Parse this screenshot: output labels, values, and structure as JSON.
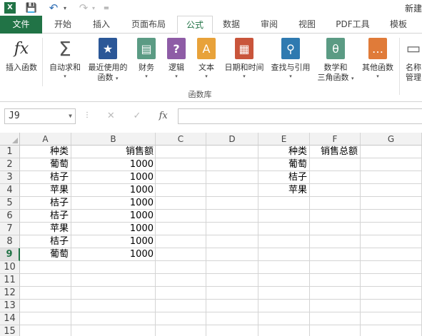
{
  "app": {
    "logo_text": "X",
    "title": "新建",
    "save_glyph": "💾",
    "undo_glyph": "↶",
    "redo_glyph": "↷",
    "dropdown_glyph": "▾",
    "customize_glyph": "="
  },
  "tabs": [
    "文件",
    "开始",
    "插入",
    "页面布局",
    "公式",
    "数据",
    "审阅",
    "视图",
    "PDF工具",
    "模板"
  ],
  "active_tab": "公式",
  "ribbon": {
    "buttons": [
      {
        "id": "insert-function",
        "icon": "fx",
        "label": "插入函数",
        "label2": "",
        "caret": false,
        "color": ""
      },
      {
        "id": "autosum",
        "icon": "Σ",
        "label": "自动求和",
        "label2": "",
        "caret": true,
        "color": ""
      },
      {
        "id": "recent",
        "icon": "★",
        "label": "最近使用的",
        "label2": "函数",
        "caret": true,
        "color": "#2b5797"
      },
      {
        "id": "financial",
        "icon": "▤",
        "label": "财务",
        "label2": "",
        "caret": true,
        "color": "#5b9b84"
      },
      {
        "id": "logical",
        "icon": "?",
        "label": "逻辑",
        "label2": "",
        "caret": true,
        "color": "#8e5ca6"
      },
      {
        "id": "text",
        "icon": "A",
        "label": "文本",
        "label2": "",
        "caret": true,
        "color": "#e8a23a"
      },
      {
        "id": "datetime",
        "icon": "▦",
        "label": "日期和时间",
        "label2": "",
        "caret": true,
        "color": "#c9553b"
      },
      {
        "id": "lookup",
        "icon": "⚲",
        "label": "查找与引用",
        "label2": "",
        "caret": true,
        "color": "#2f7ab0"
      },
      {
        "id": "math",
        "icon": "θ",
        "label": "数学和",
        "label2": "三角函数",
        "caret": true,
        "color": "#5b9b84"
      },
      {
        "id": "more",
        "icon": "…",
        "label": "其他函数",
        "label2": "",
        "caret": true,
        "color": "#e07b39"
      },
      {
        "id": "name-manager",
        "icon": "▭",
        "label": "名称",
        "label2": "管理",
        "caret": false,
        "color": ""
      }
    ],
    "group_label": "函数库"
  },
  "formula_bar": {
    "name_box": "J9",
    "cancel_glyph": "✕",
    "enter_glyph": "✓",
    "fx_glyph": "fx",
    "dots": "⋮",
    "content": ""
  },
  "sheet": {
    "columns": [
      "A",
      "B",
      "C",
      "D",
      "E",
      "F",
      "G"
    ],
    "rows": [
      "1",
      "2",
      "3",
      "4",
      "5",
      "6",
      "7",
      "8",
      "9",
      "10",
      "11",
      "12",
      "13",
      "14",
      "15"
    ],
    "selected_row": "9",
    "cells": {
      "A1": "种类",
      "B1": "销售额",
      "A2": "葡萄",
      "B2": "1000",
      "A3": "桔子",
      "B3": "1000",
      "A4": "苹果",
      "B4": "1000",
      "A5": "桔子",
      "B5": "1000",
      "A6": "桔子",
      "B6": "1000",
      "A7": "苹果",
      "B7": "1000",
      "A8": "桔子",
      "B8": "1000",
      "A9": "葡萄",
      "B9": "1000",
      "E1": "种类",
      "F1": "销售总额",
      "E2": "葡萄",
      "E3": "桔子",
      "E4": "苹果"
    }
  }
}
